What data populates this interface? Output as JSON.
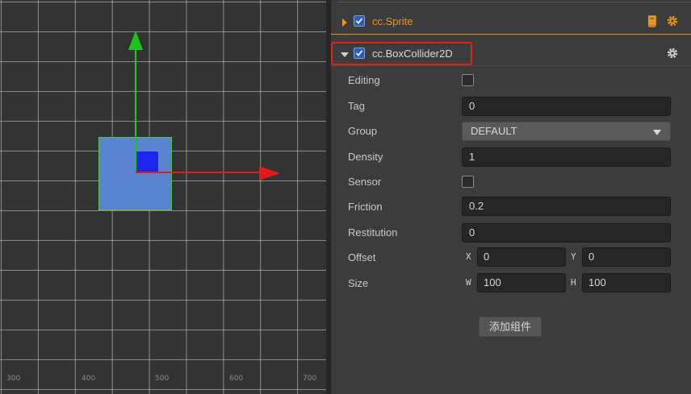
{
  "scene": {
    "ruler_labels": [
      "300",
      "400",
      "500",
      "600",
      "700"
    ]
  },
  "inspector": {
    "sprite": {
      "title": "cc.Sprite",
      "enabled": true,
      "color": "#e8961d"
    },
    "box_collider": {
      "title": "cc.BoxCollider2D",
      "enabled": true,
      "properties": {
        "editing": {
          "label": "Editing",
          "checked": false
        },
        "tag": {
          "label": "Tag",
          "value": "0"
        },
        "group": {
          "label": "Group",
          "value": "DEFAULT"
        },
        "density": {
          "label": "Density",
          "value": "1"
        },
        "sensor": {
          "label": "Sensor",
          "checked": false
        },
        "friction": {
          "label": "Friction",
          "value": "0.2"
        },
        "restitution": {
          "label": "Restitution",
          "value": "0"
        },
        "offset": {
          "label": "Offset",
          "x_label": "X",
          "x": "0",
          "y_label": "Y",
          "y": "0"
        },
        "size": {
          "label": "Size",
          "w_label": "W",
          "w": "100",
          "h_label": "H",
          "h": "100"
        }
      }
    },
    "add_component_label": "添加组件"
  },
  "colors": {
    "accent": "#e8961d",
    "highlight": "#e0201b",
    "x_axis": "#e01b1b",
    "y_axis": "#1ec41e"
  }
}
